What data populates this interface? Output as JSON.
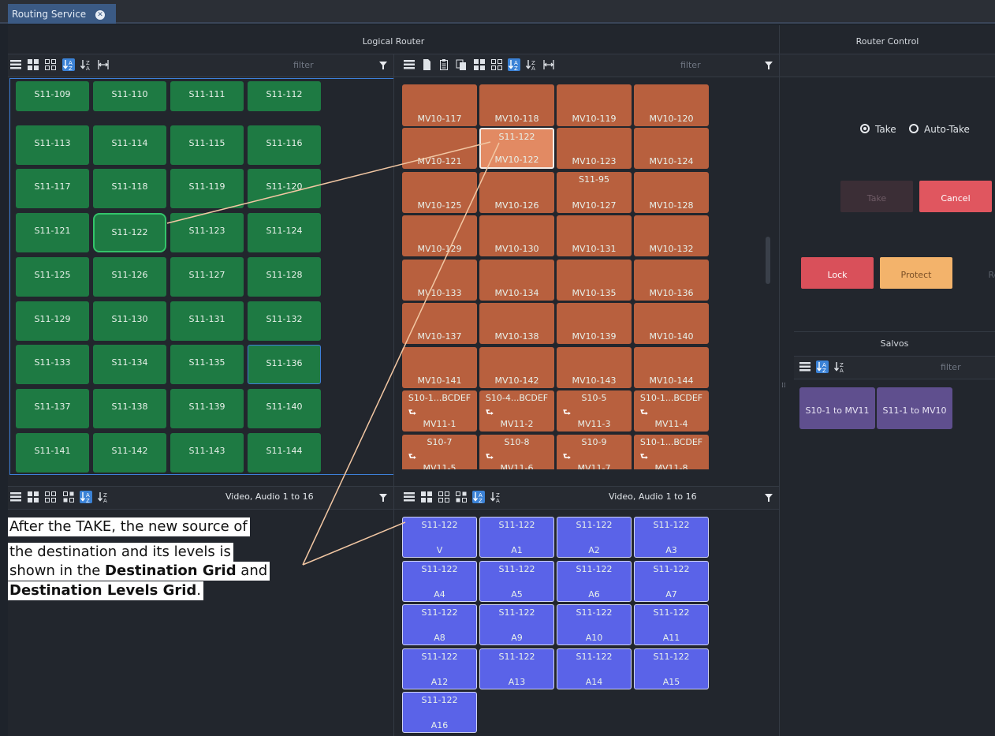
{
  "tab": {
    "title": "Routing Service"
  },
  "logical_router": {
    "title": "Logical Router",
    "filter_placeholder": "filter"
  },
  "sources": [
    "S11-109",
    "S11-110",
    "S11-111",
    "S11-112",
    "S11-113",
    "S11-114",
    "S11-115",
    "S11-116",
    "S11-117",
    "S11-118",
    "S11-119",
    "S11-120",
    "S11-121",
    "S11-122",
    "S11-123",
    "S11-124",
    "S11-125",
    "S11-126",
    "S11-127",
    "S11-128",
    "S11-129",
    "S11-130",
    "S11-131",
    "S11-132",
    "S11-133",
    "S11-134",
    "S11-135",
    "S11-136",
    "S11-137",
    "S11-138",
    "S11-139",
    "S11-140",
    "S11-141",
    "S11-142",
    "S11-143",
    "S11-144"
  ],
  "destinations": [
    {
      "src": "",
      "dst": "MV10-117"
    },
    {
      "src": "",
      "dst": "MV10-118"
    },
    {
      "src": "",
      "dst": "MV10-119"
    },
    {
      "src": "",
      "dst": "MV10-120"
    },
    {
      "src": "",
      "dst": "MV10-121"
    },
    {
      "src": "S11-122",
      "dst": "MV10-122"
    },
    {
      "src": "",
      "dst": "MV10-123"
    },
    {
      "src": "",
      "dst": "MV10-124"
    },
    {
      "src": "",
      "dst": "MV10-125"
    },
    {
      "src": "",
      "dst": "MV10-126"
    },
    {
      "src": "S11-95",
      "dst": "MV10-127"
    },
    {
      "src": "",
      "dst": "MV10-128"
    },
    {
      "src": "",
      "dst": "MV10-129"
    },
    {
      "src": "",
      "dst": "MV10-130"
    },
    {
      "src": "",
      "dst": "MV10-131"
    },
    {
      "src": "",
      "dst": "MV10-132"
    },
    {
      "src": "",
      "dst": "MV10-133"
    },
    {
      "src": "",
      "dst": "MV10-134"
    },
    {
      "src": "",
      "dst": "MV10-135"
    },
    {
      "src": "",
      "dst": "MV10-136"
    },
    {
      "src": "",
      "dst": "MV10-137"
    },
    {
      "src": "",
      "dst": "MV10-138"
    },
    {
      "src": "",
      "dst": "MV10-139"
    },
    {
      "src": "",
      "dst": "MV10-140"
    },
    {
      "src": "",
      "dst": "MV10-141"
    },
    {
      "src": "",
      "dst": "MV10-142"
    },
    {
      "src": "",
      "dst": "MV10-143"
    },
    {
      "src": "",
      "dst": "MV10-144"
    },
    {
      "src": "S10-1...BCDEF",
      "dst": "MV11-1"
    },
    {
      "src": "S10-4...BCDEF",
      "dst": "MV11-2"
    },
    {
      "src": "S10-5",
      "dst": "MV11-3"
    },
    {
      "src": "S10-1...BCDEF",
      "dst": "MV11-4"
    },
    {
      "src": "S10-7",
      "dst": "MV11-5"
    },
    {
      "src": "S10-8",
      "dst": "MV11-6"
    },
    {
      "src": "S10-9",
      "dst": "MV11-7"
    },
    {
      "src": "S10-1...BCDEF",
      "dst": "MV11-8"
    }
  ],
  "source_levels": {
    "title": "Video, Audio 1 to 16"
  },
  "destination_levels": {
    "title": "Video, Audio 1 to 16"
  },
  "levels": [
    {
      "src": "S11-122",
      "lvl": "V"
    },
    {
      "src": "S11-122",
      "lvl": "A1"
    },
    {
      "src": "S11-122",
      "lvl": "A2"
    },
    {
      "src": "S11-122",
      "lvl": "A3"
    },
    {
      "src": "S11-122",
      "lvl": "A4"
    },
    {
      "src": "S11-122",
      "lvl": "A5"
    },
    {
      "src": "S11-122",
      "lvl": "A6"
    },
    {
      "src": "S11-122",
      "lvl": "A7"
    },
    {
      "src": "S11-122",
      "lvl": "A8"
    },
    {
      "src": "S11-122",
      "lvl": "A9"
    },
    {
      "src": "S11-122",
      "lvl": "A10"
    },
    {
      "src": "S11-122",
      "lvl": "A11"
    },
    {
      "src": "S11-122",
      "lvl": "A12"
    },
    {
      "src": "S11-122",
      "lvl": "A13"
    },
    {
      "src": "S11-122",
      "lvl": "A14"
    },
    {
      "src": "S11-122",
      "lvl": "A15"
    },
    {
      "src": "S11-122",
      "lvl": "A16"
    }
  ],
  "router_control": {
    "title": "Router Control",
    "take_mode_label": "Take",
    "auto_take_label": "Auto-Take",
    "take_button": "Take",
    "cancel_button": "Cancel",
    "lock_button": "Lock",
    "protect_button": "Protect",
    "release_button": "Rel",
    "colors": {
      "cancel": "#e0565f",
      "lock": "#d9505a",
      "protect": "#f3b36b",
      "take_disabled": "#3b2e36"
    }
  },
  "salvos": {
    "title": "Salvos",
    "filter_placeholder": "filter",
    "items": [
      "S10-1 to MV11",
      "S11-1 to MV10"
    ]
  },
  "annotation": {
    "line1": "After the TAKE, the new source of",
    "line2": "the destination and its levels is",
    "line3_pre": "shown in the ",
    "line3_bold": "Destination Grid",
    "line3_post": " and",
    "line4_bold": "Destination Levels Grid",
    "line4_post": "."
  },
  "colors": {
    "source_button": "#1e7a43",
    "destination_button": "#b8603e",
    "level_button": "#5a63e8",
    "salvo_button": "#5f4f8e",
    "highlight_icon": "#3b82d6"
  }
}
